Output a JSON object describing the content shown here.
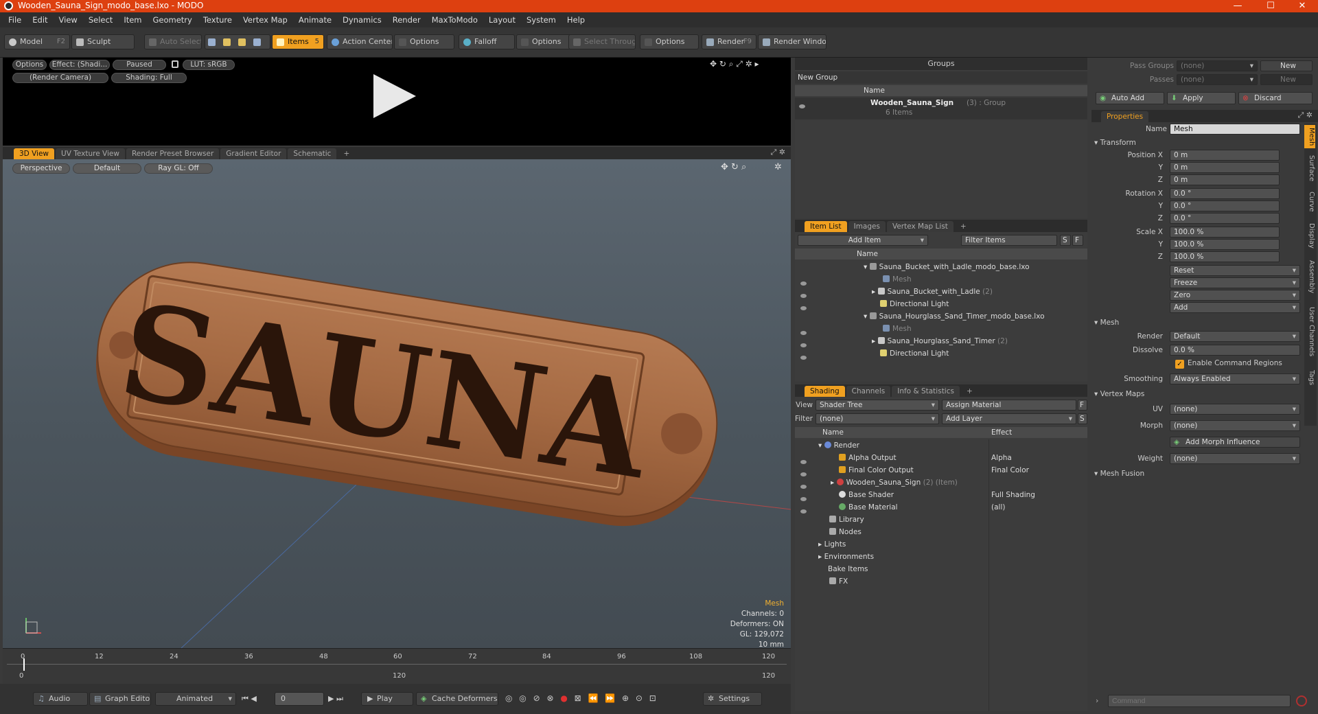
{
  "window": {
    "title": "Wooden_Sauna_Sign_modo_base.lxo - MODO",
    "minimize": "—",
    "maximize": "☐",
    "close": "✕"
  },
  "menu": [
    "File",
    "Edit",
    "View",
    "Select",
    "Item",
    "Geometry",
    "Texture",
    "Vertex Map",
    "Animate",
    "Dynamics",
    "Render",
    "MaxToModo",
    "Layout",
    "System",
    "Help"
  ],
  "toolbar": {
    "model": "Model",
    "model_key": "F2",
    "sculpt": "Sculpt",
    "auto_select": "Auto Select",
    "items": "Items",
    "items_key": "5",
    "action_center": "Action Center",
    "options1": "Options",
    "falloff": "Falloff",
    "options2": "Options",
    "select_through": "Select Through",
    "options3": "Options",
    "render": "Render",
    "render_key": "F9",
    "render_window": "Render Window"
  },
  "preview": {
    "options": "Options",
    "effect": "Effect: (Shadi...",
    "paused": "Paused",
    "lut": "LUT: sRGB",
    "camera": "(Render Camera)",
    "shading": "Shading: Full"
  },
  "viewport_tabs": [
    "3D View",
    "UV Texture View",
    "Render Preset Browser",
    "Gradient Editor",
    "Schematic",
    "+"
  ],
  "viewport": {
    "perspective": "Perspective",
    "default": "Default",
    "raygl": "Ray GL: Off",
    "sign_text": "SAUNA",
    "stats": {
      "type": "Mesh",
      "channels": "Channels: 0",
      "deformers": "Deformers: ON",
      "gl": "GL: 129,072",
      "scale": "10 mm"
    }
  },
  "timeline": {
    "top_ticks": [
      "0",
      "12",
      "24",
      "36",
      "48",
      "60",
      "72",
      "84",
      "96",
      "108",
      "120"
    ],
    "bottom_ticks": [
      "0",
      "120",
      "120"
    ]
  },
  "bottom": {
    "audio": "Audio",
    "graph_editor": "Graph Editor",
    "animated": "Animated",
    "frame": "0",
    "play": "Play",
    "cache_deformers": "Cache Deformers",
    "settings": "Settings"
  },
  "groups": {
    "title": "Groups",
    "new_group": "New Group",
    "col_name": "Name",
    "item_name": "Wooden_Sauna_Sign",
    "item_count": "(3) : Group",
    "item_sub": "6 Items"
  },
  "itemlist": {
    "tabs": [
      "Item List",
      "Images",
      "Vertex Map List",
      "+"
    ],
    "add_item": "Add Item",
    "filter_items": "Filter Items",
    "s": "S",
    "f": "F",
    "col_name": "Name",
    "rows": [
      {
        "label": "Sauna_Bucket_with_Ladle_modo_base.lxo",
        "indent": 0,
        "kind": "scene"
      },
      {
        "label": "Mesh",
        "indent": 2,
        "kind": "mesh"
      },
      {
        "label": "Sauna_Bucket_with_Ladle",
        "indent": 1,
        "kind": "group",
        "count": "(2)"
      },
      {
        "label": "Directional Light",
        "indent": 1,
        "kind": "light"
      },
      {
        "label": "Sauna_Hourglass_Sand_Timer_modo_base.lxo",
        "indent": 0,
        "kind": "scene"
      },
      {
        "label": "Mesh",
        "indent": 2,
        "kind": "mesh"
      },
      {
        "label": "Sauna_Hourglass_Sand_Timer",
        "indent": 1,
        "kind": "group",
        "count": "(2)"
      },
      {
        "label": "Directional Light",
        "indent": 1,
        "kind": "light"
      }
    ]
  },
  "shading": {
    "tabs": [
      "Shading",
      "Channels",
      "Info & Statistics",
      "+"
    ],
    "view_label": "View",
    "view_value": "Shader Tree",
    "assign_material": "Assign Material",
    "f": "F",
    "filter_label": "Filter",
    "filter_value": "(none)",
    "add_layer": "Add Layer",
    "s": "S",
    "col_name": "Name",
    "col_effect": "Effect",
    "rows": [
      {
        "label": "Render",
        "effect": "",
        "indent": 0
      },
      {
        "label": "Alpha Output",
        "effect": "Alpha",
        "indent": 1
      },
      {
        "label": "Final Color Output",
        "effect": "Final Color",
        "indent": 1
      },
      {
        "label": "Wooden_Sauna_Sign",
        "effect": "",
        "indent": 1,
        "suffix": "(2) (Item)"
      },
      {
        "label": "Base Shader",
        "effect": "Full Shading",
        "indent": 1
      },
      {
        "label": "Base Material",
        "effect": "(all)",
        "indent": 1
      },
      {
        "label": "Library",
        "effect": "",
        "indent": 2
      },
      {
        "label": "Nodes",
        "effect": "",
        "indent": 2
      },
      {
        "label": "Lights",
        "effect": "",
        "indent": 0
      },
      {
        "label": "Environments",
        "effect": "",
        "indent": 0
      },
      {
        "label": "Bake Items",
        "effect": "",
        "indent": 0
      },
      {
        "label": "FX",
        "effect": "",
        "indent": 0
      }
    ]
  },
  "properties": {
    "pass_groups": "Pass Groups",
    "passes": "Passes",
    "none": "(none)",
    "new": "New",
    "auto_add": "Auto Add",
    "apply": "Apply",
    "discard": "Discard",
    "tab": "Properties",
    "name_label": "Name",
    "name_value": "Mesh",
    "transform": "Transform",
    "pos_x_label": "Position X",
    "y": "Y",
    "z": "Z",
    "zero_m": "0 m",
    "rot_x_label": "Rotation X",
    "zero_deg": "0.0 °",
    "scale_x_label": "Scale X",
    "hundred": "100.0 %",
    "reset": "Reset",
    "freeze": "Freeze",
    "zero": "Zero",
    "add": "Add",
    "mesh": "Mesh",
    "render_label": "Render",
    "render_value": "Default",
    "dissolve_label": "Dissolve",
    "dissolve_value": "0.0 %",
    "enable_cmd": "Enable Command Regions",
    "smoothing_label": "Smoothing",
    "smoothing_value": "Always Enabled",
    "vertex_maps": "Vertex Maps",
    "uv_label": "UV",
    "uv_value": "(none)",
    "morph_label": "Morph",
    "morph_value": "(none)",
    "add_morph": "Add Morph Influence",
    "weight_label": "Weight",
    "weight_value": "(none)",
    "mesh_fusion": "Mesh Fusion",
    "vtabs": [
      "Mesh",
      "Surface",
      "Curve",
      "Display",
      "Assembly",
      "User Channels",
      "Tags"
    ],
    "command_placeholder": "Command"
  }
}
